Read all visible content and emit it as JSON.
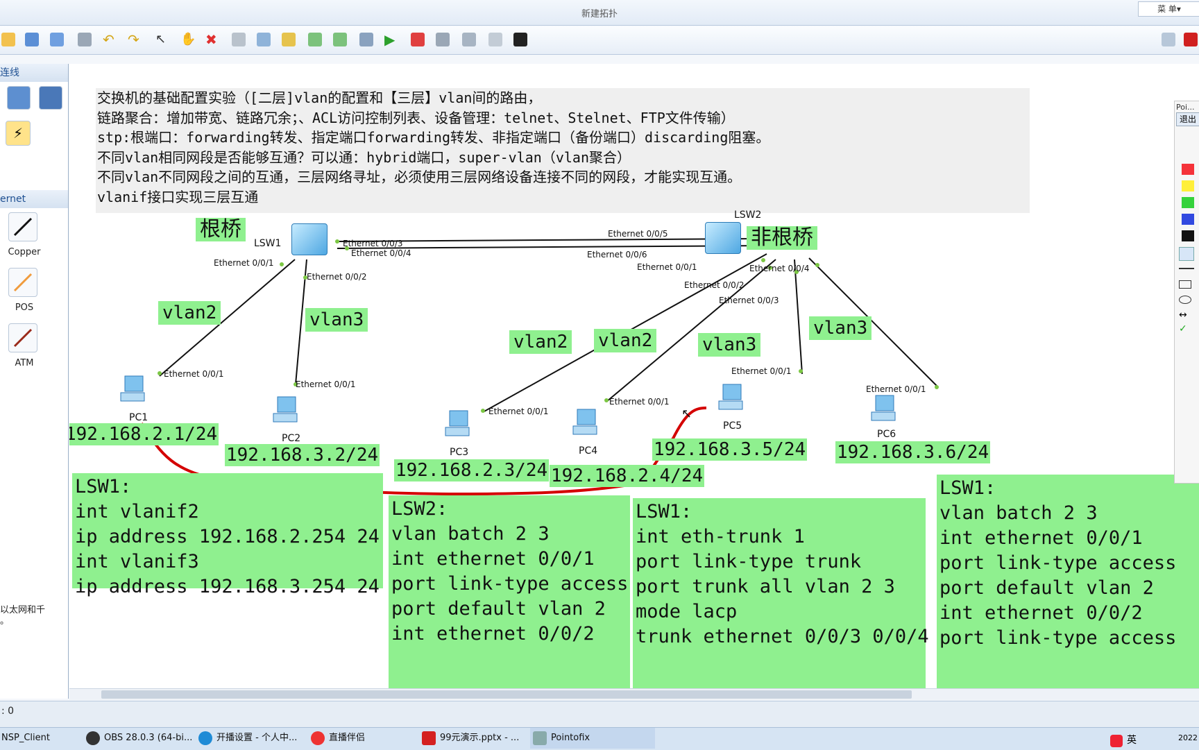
{
  "window": {
    "title": "新建拓扑",
    "menu_label": "菜 单▾"
  },
  "toolbar": {
    "icons": [
      "home-icon",
      "save-icon",
      "save-as-icon",
      "print-icon",
      "undo-icon",
      "redo-icon",
      "select-icon",
      "hand-icon",
      "delete-icon",
      "delete-link-icon",
      "text-icon",
      "palette-icon",
      "zoom-in-icon",
      "zoom-out-icon",
      "fit-icon",
      "start-icon",
      "stop-icon",
      "capture-icon",
      "topology-icon",
      "grid-icon",
      "terminal-icon"
    ]
  },
  "left_panel": {
    "header_links": "连线",
    "header_ethernet": "ernet",
    "tools": [
      {
        "label": "Copper"
      },
      {
        "label": "POS"
      },
      {
        "label": "ATM"
      }
    ],
    "description": "以太网和千\n。"
  },
  "notes": "交换机的基础配置实验（[二层]vlan的配置和【三层】vlan间的路由，\n链路聚合：增加带宽、链路冗余；、ACL访问控制列表、设备管理：telnet、Stelnet、FTP文件传输）\nstp:根端口：forwarding转发、指定端口forwarding转发、非指定端口（备份端口）discarding阻塞。\n不同vlan相同网段是否能够互通？可以通：hybrid端口，super-vlan（vlan聚合）\n不同vlan不同网段之间的互通，三层网络寻址，必须使用三层网络设备连接不同的网段，才能实现互通。\nvlanif接口实现三层互通",
  "labels": {
    "root_bridge": "根桥",
    "non_root_bridge": "非根桥"
  },
  "devices": {
    "lsw1": "LSW1",
    "lsw2": "LSW2",
    "pc1": "PC1",
    "pc2": "PC2",
    "pc3": "PC3",
    "pc4": "PC4",
    "pc5": "PC5",
    "pc6": "PC6"
  },
  "ports": {
    "lsw1_p3": "Ethernet 0/0/3",
    "lsw1_p4": "Ethernet 0/0/4",
    "lsw1_p1": "Ethernet 0/0/1",
    "lsw1_p2": "Ethernet 0/0/2",
    "lsw2_p5": "Ethernet 0/0/5",
    "lsw2_p6": "Ethernet 0/0/6",
    "lsw2_p1": "Ethernet 0/0/1",
    "lsw2_p2": "Ethernet 0/0/2",
    "lsw2_p3": "Ethernet 0/0/3",
    "lsw2_p4": "Ethernet 0/0/4",
    "pc1_p": "Ethernet 0/0/1",
    "pc2_p": "Ethernet 0/0/1",
    "pc3_p": "Ethernet 0/0/1",
    "pc4_p": "Ethernet 0/0/1",
    "pc5_p": "Ethernet 0/0/1",
    "pc6_p": "Ethernet 0/0/1"
  },
  "vlans": {
    "pc1": "vlan2",
    "pc2": "vlan3",
    "pc3": "vlan2",
    "pc4": "vlan2",
    "pc5": "vlan3",
    "pc6": "vlan3"
  },
  "ips": {
    "pc1": "192.168.2.1/24",
    "pc2": "192.168.3.2/24",
    "pc3": "192.168.2.3/24",
    "pc4": "192.168.2.4/24",
    "pc5": "192.168.3.5/24",
    "pc6": "192.168.3.6/24"
  },
  "code_blocks": {
    "lsw1_vlanif": "LSW1:\nint vlanif2\nip address 192.168.2.254 24\nint vlanif3\nip address 192.168.3.254 24",
    "lsw2_access": "LSW2:\nvlan batch 2 3\nint ethernet 0/0/1\nport link-type access\nport default vlan 2\nint ethernet 0/0/2",
    "lsw1_trunk": "LSW1:\nint eth-trunk 1\nport link-type trunk\nport trunk all vlan 2 3\nmode lacp\ntrunk ethernet 0/0/3 0/0/4",
    "lsw1_batch": "LSW1:\nvlan batch 2 3\nint ethernet 0/0/1\nport link-type access\nport default vlan 2\nint ethernet 0/0/2\nport link-type access"
  },
  "right_panel": {
    "title": "Poi...",
    "exit": "退出"
  },
  "status": {
    "left": ": 0"
  },
  "taskbar": {
    "items": [
      "NSP_Client",
      "OBS 28.0.3 (64-bi...",
      "开播设置 - 个人中...",
      "直播伴侣",
      "99元演示.pptx - ...",
      "Pointofix"
    ],
    "ime": "英",
    "clock": "2022"
  },
  "colors": {
    "note_bg": "#efefef",
    "tag_bg": "#8ff08f",
    "annotation": "#d40000"
  }
}
